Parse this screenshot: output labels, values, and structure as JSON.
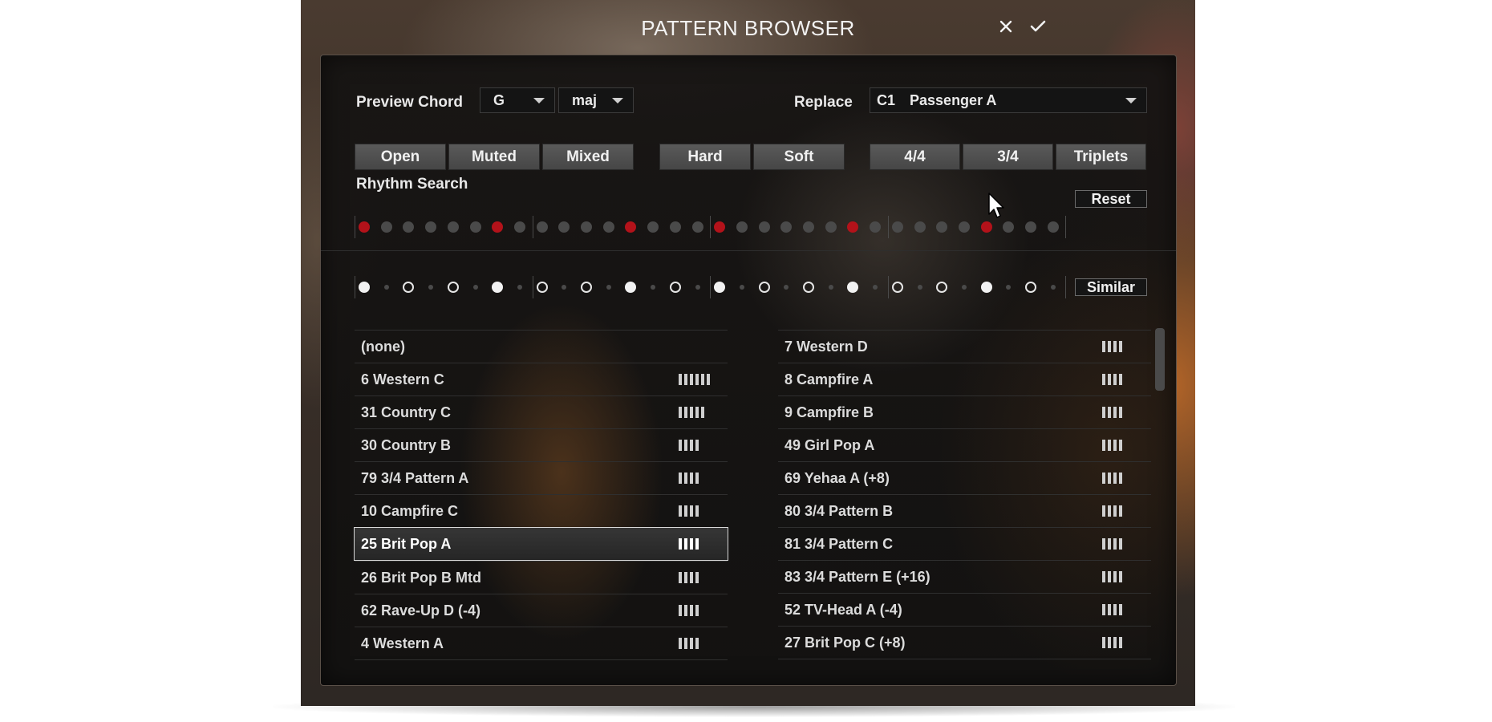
{
  "window": {
    "title": "PATTERN BROWSER",
    "close_icon": "close-icon",
    "confirm_icon": "checkmark-icon"
  },
  "controls": {
    "preview_label": "Preview Chord",
    "chord_root": "G",
    "chord_type": "maj",
    "replace_label": "Replace",
    "replace_slot": "C1",
    "replace_value": "Passenger A"
  },
  "filters": {
    "style": [
      "Open",
      "Muted",
      "Mixed"
    ],
    "dynamics": [
      "Hard",
      "Soft"
    ],
    "meter": [
      "4/4",
      "3/4",
      "Triplets"
    ]
  },
  "rhythm_search": {
    "label": "Rhythm Search",
    "reset_label": "Reset",
    "steps": [
      1,
      0,
      0,
      0,
      0,
      0,
      1,
      0,
      0,
      0,
      0,
      0,
      1,
      0,
      0,
      0,
      1,
      0,
      0,
      0,
      0,
      0,
      1,
      0,
      0,
      0,
      0,
      0,
      1,
      0,
      0,
      0
    ]
  },
  "similar": {
    "label": "Similar",
    "pattern": [
      "filled",
      "small",
      "open",
      "small",
      "open",
      "small",
      "filled",
      "small",
      "open",
      "small",
      "open",
      "small",
      "filled",
      "small",
      "open",
      "small",
      "filled",
      "small",
      "open",
      "small",
      "open",
      "small",
      "filled",
      "small",
      "open",
      "small",
      "open",
      "small",
      "filled",
      "small",
      "open",
      "small"
    ]
  },
  "patterns_left": [
    {
      "name": "(none)",
      "bars": 0
    },
    {
      "name": "6 Western C",
      "bars": 6
    },
    {
      "name": "31 Country C",
      "bars": 5
    },
    {
      "name": "30 Country B",
      "bars": 4
    },
    {
      "name": "79 3/4 Pattern A",
      "bars": 4
    },
    {
      "name": "10 Campfire C",
      "bars": 4
    },
    {
      "name": "25 Brit Pop A",
      "bars": 4,
      "selected": true
    },
    {
      "name": "26 Brit Pop B Mtd",
      "bars": 4
    },
    {
      "name": "62 Rave-Up D (-4)",
      "bars": 4
    },
    {
      "name": "4 Western A",
      "bars": 4
    }
  ],
  "patterns_right": [
    {
      "name": "7 Western D",
      "bars": 4
    },
    {
      "name": "8 Campfire A",
      "bars": 4
    },
    {
      "name": "9 Campfire B",
      "bars": 4
    },
    {
      "name": "49 Girl Pop A",
      "bars": 4
    },
    {
      "name": "69 Yehaa A (+8)",
      "bars": 4
    },
    {
      "name": "80 3/4 Pattern B",
      "bars": 4
    },
    {
      "name": "81 3/4 Pattern C",
      "bars": 4
    },
    {
      "name": "83 3/4 Pattern E (+16)",
      "bars": 4
    },
    {
      "name": "52 TV-Head A (-4)",
      "bars": 4
    },
    {
      "name": "27 Brit Pop C (+8)",
      "bars": 4
    }
  ],
  "colors": {
    "active_step": "#b3121a",
    "inactive_step": "#4a4a4a"
  }
}
